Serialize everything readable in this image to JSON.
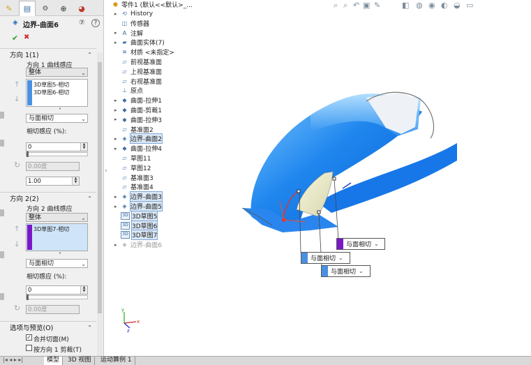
{
  "property_manager": {
    "tabs": [
      "feature-manager-icon",
      "property-manager-icon",
      "configuration-manager-icon",
      "dimxpert-icon",
      "display-manager-icon"
    ],
    "title": "边界-曲面6",
    "help": "?",
    "ok": "✔",
    "cancel": "✖",
    "dir1": {
      "header": "方向 1(1)",
      "curve_influence_label": "方向 1 曲线感应",
      "curve_influence_value": "整体",
      "items": [
        "3D草图5-相切",
        "3D草图6-相切"
      ],
      "color": "#4a90e2",
      "tangent_type": "与面相切",
      "tangent_influence_label": "相切感应 (%):",
      "tangent_influence_value": "0",
      "angle_value": "0.00度",
      "tangent_length": "1.00"
    },
    "dir2": {
      "header": "方向 2(2)",
      "curve_influence_label": "方向 2 曲线感应",
      "curve_influence_value": "整体",
      "items": [
        "3D草图7-相切"
      ],
      "color": "#7a18c8",
      "tangent_type": "与面相切",
      "tangent_influence_label": "相切感应 (%):",
      "tangent_influence_value": "0",
      "angle_value": "0.00度"
    },
    "options": {
      "header": "选项与预览(O)",
      "merge_faces": "合并切面(M)",
      "merge_checked": true,
      "trim_dir1": "按方向 1 剪裁(T)",
      "trim_checked": false
    }
  },
  "feature_tree": {
    "root": "零件1 (默认<<默认>_...",
    "items": [
      {
        "label": "History",
        "icon": "history-icon",
        "expand": true
      },
      {
        "label": "传感器",
        "icon": "sensor-icon",
        "expand": false
      },
      {
        "label": "注解",
        "icon": "annotation-icon",
        "expand": true
      },
      {
        "label": "曲面实体(7)",
        "icon": "surface-bodies-icon",
        "expand": true
      },
      {
        "label": "材质 <未指定>",
        "icon": "material-icon",
        "expand": false
      },
      {
        "label": "前视基准面",
        "icon": "plane-icon",
        "expand": false
      },
      {
        "label": "上视基准面",
        "icon": "plane-icon",
        "expand": false
      },
      {
        "label": "右视基准面",
        "icon": "plane-icon",
        "expand": false
      },
      {
        "label": "原点",
        "icon": "origin-icon",
        "expand": false
      },
      {
        "label": "曲面-拉伸1",
        "icon": "surface-extrude-icon",
        "expand": true
      },
      {
        "label": "曲面-剪裁1",
        "icon": "surface-trim-icon",
        "expand": true
      },
      {
        "label": "曲面-拉伸3",
        "icon": "surface-extrude-icon",
        "expand": true
      },
      {
        "label": "基准面2",
        "icon": "plane-icon",
        "expand": false
      },
      {
        "label": "边界-曲面2",
        "icon": "boundary-surface-icon",
        "expand": true,
        "hl": true
      },
      {
        "label": "曲面-拉伸4",
        "icon": "surface-extrude-icon",
        "expand": true
      },
      {
        "label": "草图11",
        "icon": "sketch-icon",
        "expand": false
      },
      {
        "label": "草图12",
        "icon": "sketch-icon",
        "expand": false
      },
      {
        "label": "基准面3",
        "icon": "plane-icon",
        "expand": false
      },
      {
        "label": "基准面4",
        "icon": "plane-icon",
        "expand": false
      },
      {
        "label": "边界-曲面3",
        "icon": "boundary-surface-icon",
        "expand": true,
        "hl": true
      },
      {
        "label": "边界-曲面5",
        "icon": "boundary-surface-icon",
        "expand": true,
        "hl": true
      },
      {
        "label": "3D草图5",
        "icon": "3d-sketch-icon",
        "expand": false,
        "hl": true
      },
      {
        "label": "3D草图6",
        "icon": "3d-sketch-icon",
        "expand": false,
        "hl": true
      },
      {
        "label": "3D草图7",
        "icon": "3d-sketch-icon",
        "expand": false,
        "hl": true
      },
      {
        "label": "边界-曲面6",
        "icon": "boundary-surface-icon",
        "expand": true,
        "gray": true
      }
    ]
  },
  "callouts": [
    {
      "label": "与面相切",
      "color": "#7a18c8"
    },
    {
      "label": "与面相切",
      "color": "#4a90e2"
    },
    {
      "label": "与面相切",
      "color": "#4a90e2"
    }
  ],
  "bottom_tabs": [
    "模型",
    "3D 视图",
    "运动算例 1"
  ]
}
